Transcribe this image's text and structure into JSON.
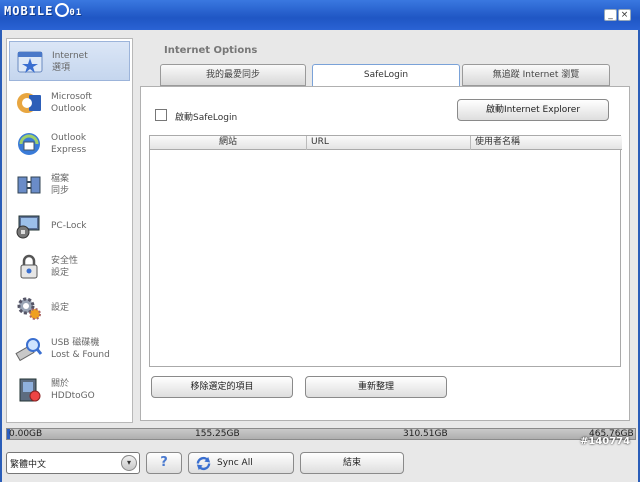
{
  "titlebar": {
    "logo_text": "MOBILE",
    "logo_suffix": "01",
    "minimize_glyph": "_",
    "close_glyph": "×"
  },
  "sidebar": {
    "items": [
      {
        "label_line1": "Internet",
        "label_line2": "選項",
        "icon": "internet-star-icon",
        "active": true
      },
      {
        "label_line1": "Microsoft",
        "label_line2": "Outlook",
        "icon": "outlook-icon",
        "active": false
      },
      {
        "label_line1": "Outlook",
        "label_line2": "Express",
        "icon": "outlook-express-icon",
        "active": false
      },
      {
        "label_line1": "檔案",
        "label_line2": "同步",
        "icon": "file-sync-icon",
        "active": false
      },
      {
        "label_line1": "PC-Lock",
        "label_line2": "",
        "icon": "pc-lock-icon",
        "active": false
      },
      {
        "label_line1": "安全性",
        "label_line2": "設定",
        "icon": "security-lock-icon",
        "active": false
      },
      {
        "label_line1": "設定",
        "label_line2": "",
        "icon": "settings-gear-icon",
        "active": false
      },
      {
        "label_line1": "USB 磁碟機",
        "label_line2": "Lost & Found",
        "icon": "usb-search-icon",
        "active": false
      },
      {
        "label_line1": "關於",
        "label_line2": "HDDtoGO",
        "icon": "about-icon",
        "active": false
      }
    ]
  },
  "content": {
    "section_title": "Internet Options",
    "tabs": [
      {
        "label": "我的最愛同步",
        "active": false
      },
      {
        "label": "SafeLogin",
        "active": true
      },
      {
        "label": "無追蹤 Internet 瀏覽",
        "active": false
      }
    ],
    "enable_safelogin_label": "啟動SafeLogin",
    "launch_ie_label": "啟動Internet Explorer",
    "table": {
      "columns": [
        "網站",
        "URL",
        "使用者名稱"
      ],
      "rows": []
    },
    "remove_selected_label": "移除選定的項目",
    "reorganize_label": "重新整理"
  },
  "storage": {
    "used_fraction": 0.005,
    "labels": [
      "0.00GB",
      "155.25GB",
      "310.51GB",
      "465.76GB"
    ],
    "fill_color": "#2d5fc0"
  },
  "bottom": {
    "language_value": "繁體中文",
    "help_glyph": "?",
    "sync_all_label": "Sync All",
    "exit_label": "結束"
  },
  "watermark": "#140774"
}
